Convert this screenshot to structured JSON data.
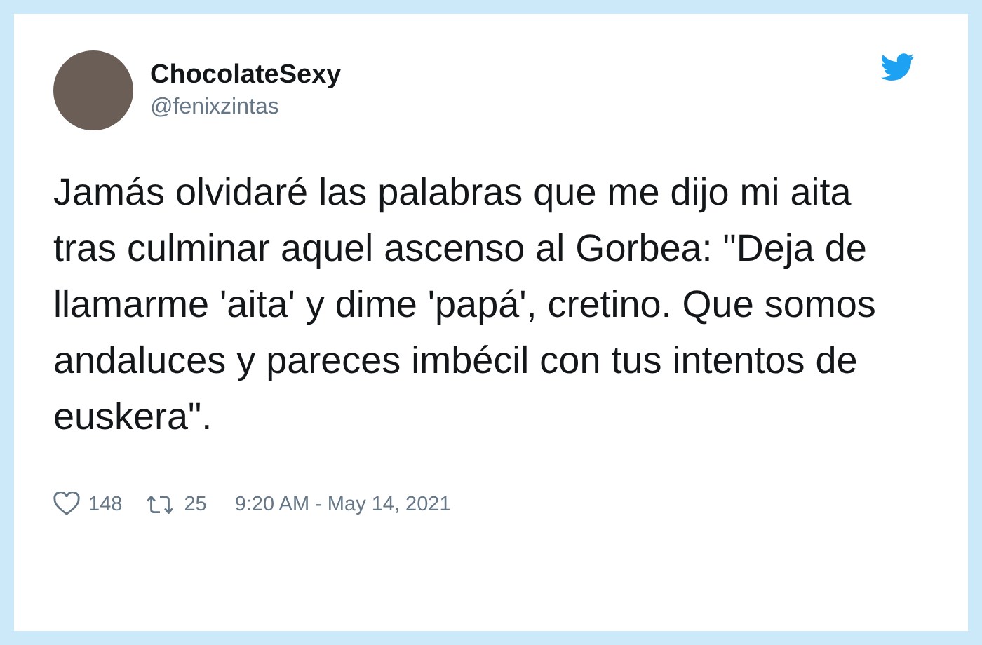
{
  "tweet": {
    "author": {
      "name": "ChocolateSexy",
      "handle": "@fenixzintas"
    },
    "text": "Jamás olvidaré las palabras que me dijo mi aita tras culminar aquel ascenso al Gorbea: \"Deja de llamarme 'aita' y dime 'papá', cretino. Que somos andaluces y pareces imbécil con tus intentos de euskera\".",
    "likes": "148",
    "retweets": "25",
    "timestamp": "9:20 AM - May 14, 2021"
  }
}
